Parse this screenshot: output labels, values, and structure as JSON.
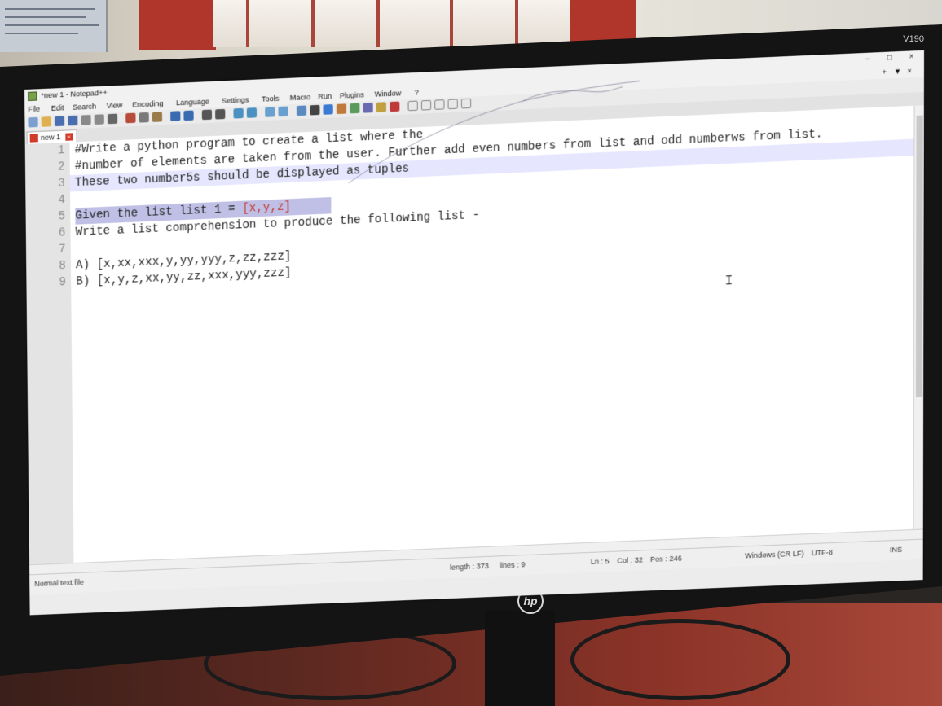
{
  "monitor": {
    "model": "V190",
    "brand": "hp"
  },
  "window": {
    "title": "*new 1 - Notepad++",
    "controls": [
      "–",
      "□",
      "×"
    ],
    "doc_controls": [
      "+",
      "▼",
      "×"
    ]
  },
  "menu": [
    "File",
    "Edit",
    "Search",
    "View",
    "Encoding",
    "Language",
    "Settings",
    "Tools",
    "Macro",
    "Run",
    "Plugins",
    "Window",
    "?"
  ],
  "tab": {
    "label": "new 1"
  },
  "editor": {
    "lines": [
      {
        "n": "1",
        "text": "#Write a python program to create a list where the"
      },
      {
        "n": "2",
        "text": "#number of elements are taken from the user. Further add even numbers from list and odd numberws from list."
      },
      {
        "n": "3",
        "text": "These two number5s should be displayed as tuples"
      },
      {
        "n": "4",
        "text": ""
      },
      {
        "n": "5",
        "pre": "Given the list list 1 = ",
        "hl": "[x,y,z]"
      },
      {
        "n": "6",
        "text": "Write a list comprehension to produce the following list -"
      },
      {
        "n": "7",
        "text": ""
      },
      {
        "n": "8",
        "text": "A) [x,xx,xxx,y,yy,yyy,z,zz,zzz]"
      },
      {
        "n": "9",
        "text": "B) [x,y,z,xx,yy,zz,xxx,yyy,zzz]"
      }
    ]
  },
  "status": {
    "file_type": "Normal text file",
    "length": "length : 373",
    "lines": "lines : 9",
    "ln": "Ln : 5",
    "col": "Col : 32",
    "pos": "Pos : 246",
    "eol": "Windows (CR LF)",
    "encoding": "UTF-8",
    "mode": "INS"
  },
  "colors": {
    "selection": "#c0c0e6",
    "current_line": "#e6e6ff",
    "brace": "#c0392b"
  }
}
